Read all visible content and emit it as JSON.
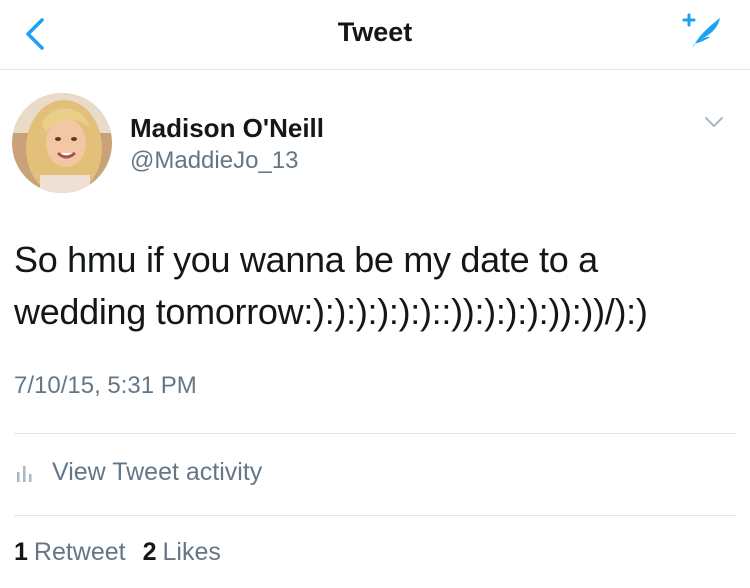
{
  "navbar": {
    "title": "Tweet",
    "back_icon": "chevron-left-icon",
    "compose_icon": "compose-tweet-icon",
    "accent_color": "#1da1f2"
  },
  "author": {
    "display_name": "Madison O'Neill",
    "handle": "@MaddieJo_13",
    "more_icon": "chevron-down-icon"
  },
  "tweet": {
    "text_line_1": "So hmu if you wanna be my date to a",
    "text_line_2": "wedding tomorrow:):):):):):)::)):):):):)):))/):)",
    "timestamp": "7/10/15, 5:31 PM"
  },
  "activity": {
    "icon": "bar-chart-icon",
    "label": "View Tweet activity"
  },
  "stats": {
    "retweets_count": "1",
    "retweets_label": "Retweet",
    "likes_count": "2",
    "likes_label": "Likes"
  }
}
